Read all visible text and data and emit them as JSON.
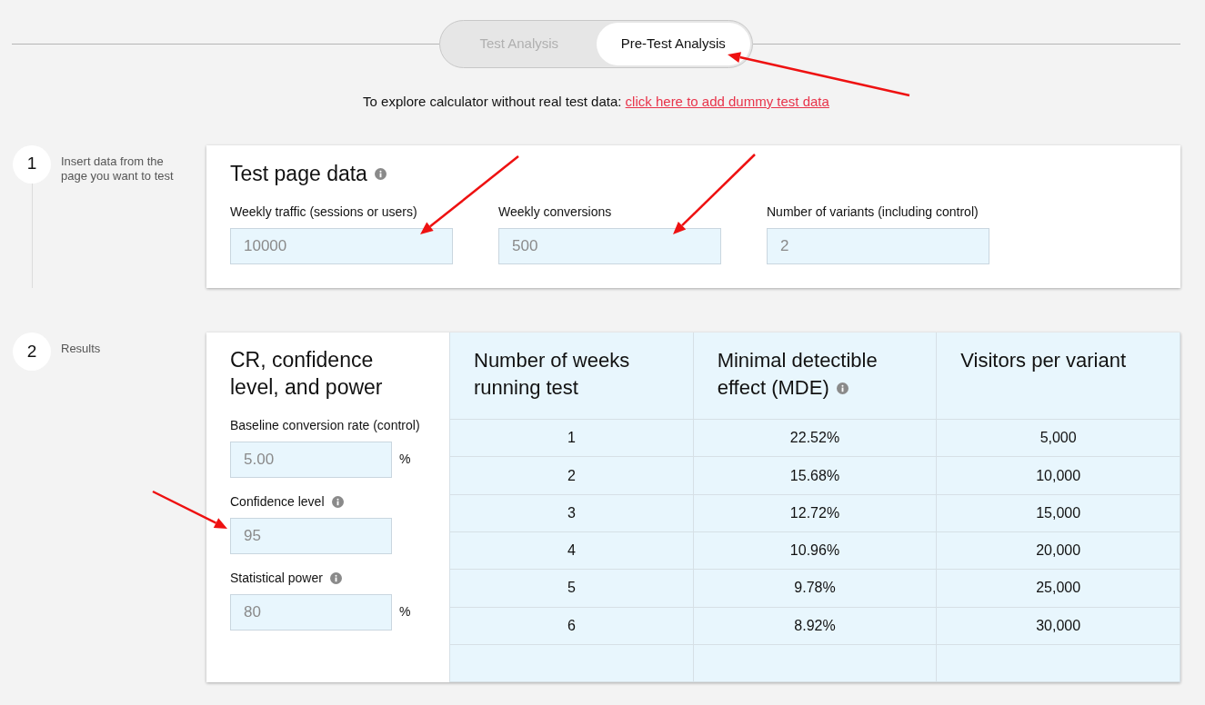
{
  "tabs": [
    {
      "label": "Test Analysis",
      "selected": false
    },
    {
      "label": "Pre-Test Analysis",
      "selected": true
    }
  ],
  "notice": {
    "text": "To explore calculator without real test data: ",
    "link": "click here to add dummy test data"
  },
  "steps": [
    {
      "number": "1",
      "label": "Insert data from the page you want to test"
    },
    {
      "number": "2",
      "label": "Results"
    }
  ],
  "test_page_data": {
    "title": "Test page data",
    "info": true,
    "fields": [
      {
        "label": "Weekly traffic (sessions or users)",
        "value": "10000"
      },
      {
        "label": "Weekly conversions",
        "value": "500"
      },
      {
        "label": "Number of variants (including control)",
        "value": "2"
      }
    ]
  },
  "results": {
    "title": "CR, confidence level, and power",
    "fields": [
      {
        "label": "Baseline conversion rate (control)",
        "info": false,
        "value": "5.00",
        "unit": "%"
      },
      {
        "label": "Confidence level",
        "info": true,
        "value": "95"
      },
      {
        "label": "Statistical power",
        "info": true,
        "value": "80",
        "unit": "%"
      }
    ],
    "table": {
      "columns": [
        {
          "label": "Number of weeks running test",
          "info": false
        },
        {
          "label": "Minimal detectible effect (MDE)",
          "info": true
        },
        {
          "label": "Visitors per variant",
          "info": false
        }
      ],
      "rows": [
        [
          "1",
          "22.52%",
          "5,000"
        ],
        [
          "2",
          "15.68%",
          "10,000"
        ],
        [
          "3",
          "12.72%",
          "15,000"
        ],
        [
          "4",
          "10.96%",
          "20,000"
        ],
        [
          "5",
          "9.78%",
          "25,000"
        ],
        [
          "6",
          "8.92%",
          "30,000"
        ]
      ]
    }
  }
}
